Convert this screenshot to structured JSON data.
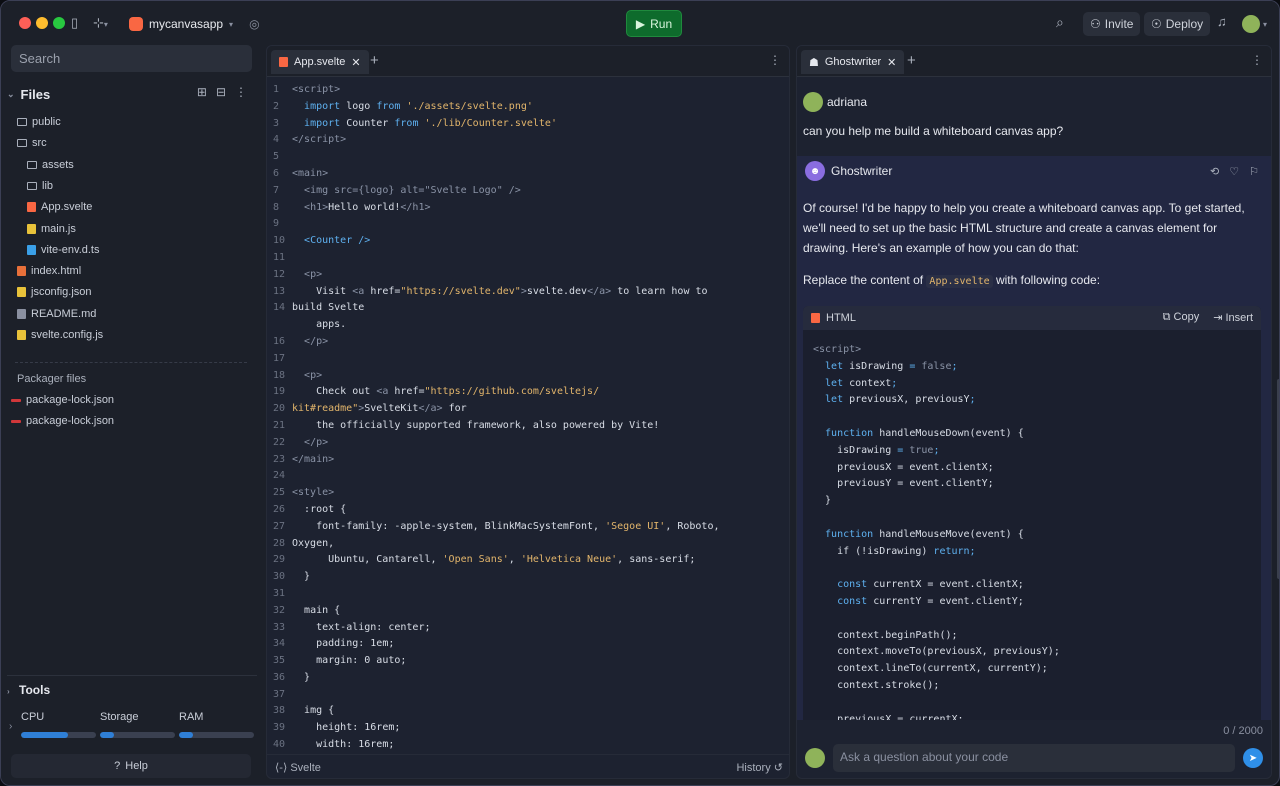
{
  "header": {
    "repl_name": "mycanvasapp",
    "run_label": "Run",
    "invite_label": "Invite",
    "deploy_label": "Deploy"
  },
  "sidebar": {
    "search_placeholder": "Search",
    "files_title": "Files",
    "tree": [
      {
        "name": "public",
        "kind": "folder"
      },
      {
        "name": "src",
        "kind": "folder"
      },
      {
        "name": "assets",
        "kind": "folder"
      },
      {
        "name": "lib",
        "kind": "folder"
      },
      {
        "name": "App.svelte",
        "kind": "svelte"
      },
      {
        "name": "main.js",
        "kind": "js"
      },
      {
        "name": "vite-env.d.ts",
        "kind": "ts"
      },
      {
        "name": "index.html",
        "kind": "html"
      },
      {
        "name": "jsconfig.json",
        "kind": "json"
      },
      {
        "name": "README.md",
        "kind": "md"
      },
      {
        "name": "svelte.config.js",
        "kind": "js"
      }
    ],
    "packager_title": "Packager files",
    "packager_files": [
      "package-lock.json",
      "package-lock.json"
    ],
    "tools_title": "Tools",
    "resources": [
      {
        "label": "CPU",
        "usage": 0.62
      },
      {
        "label": "Storage",
        "usage": 0.18
      },
      {
        "label": "RAM",
        "usage": 0.18
      }
    ],
    "help_label": "Help"
  },
  "editor": {
    "tab_label": "App.svelte",
    "footer_lang": "Svelte",
    "footer_history": "History"
  },
  "ghostwriter": {
    "tab_label": "Ghostwriter",
    "user_name": "adriana",
    "user_message": "can you help me build a whiteboard canvas app?",
    "ai_name": "Ghostwriter",
    "ai_paragraph": "Of course! I'd be happy to help you create a whiteboard canvas app. To get started, we'll need to set up the basic HTML structure and create a canvas element for drawing. Here's an example of how you can do that:",
    "replace_prefix": "Replace the content of ",
    "replace_code": "App.svelte",
    "replace_suffix": " with following code:",
    "codebox_lang": "HTML",
    "copy_label": "Copy",
    "insert_label": "Insert",
    "char_counter": "0 / 2000",
    "ask_placeholder": "Ask a question about your code"
  }
}
